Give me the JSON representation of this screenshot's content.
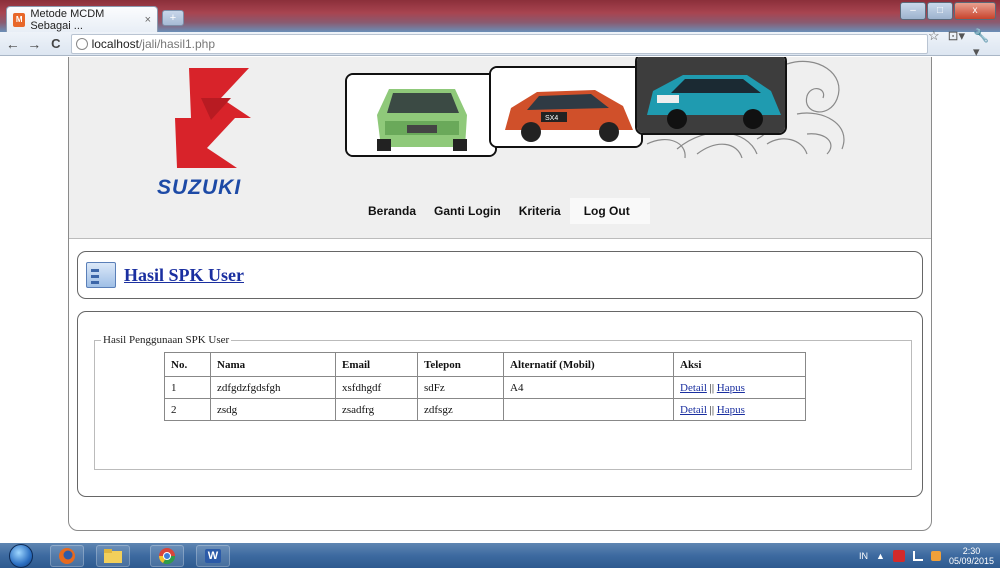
{
  "browser": {
    "tab_title": "Metode MCDM Sebagai ...",
    "tab_close": "×",
    "new_tab": "+",
    "address_host": "localhost",
    "address_path": "/jali/hasil1.php",
    "back": "←",
    "forward": "→",
    "reload": "C",
    "star": "☆",
    "page_menu": "⊡▾",
    "wrench_menu": "🔧▾",
    "win_minimize": "–",
    "win_maximize": "□",
    "win_close": "x"
  },
  "header": {
    "logo_text": "SUZUKI",
    "car_badge": "SX4"
  },
  "menu": {
    "items": [
      {
        "label": "Beranda"
      },
      {
        "label": "Ganti Login"
      },
      {
        "label": "Kriteria"
      },
      {
        "label": "Log Out"
      }
    ]
  },
  "page": {
    "title": "Hasil SPK User",
    "fieldset_legend": "Hasil Penggunaan SPK User"
  },
  "table": {
    "headers": [
      "No.",
      "Nama",
      "Email",
      "Telepon",
      "Alternatif (Mobil)",
      "Aksi"
    ],
    "rows": [
      {
        "no": "1",
        "nama": "zdfgdzfgdsfgh",
        "email": "xsfdhgdf",
        "telepon": "sdFz",
        "alternatif": "A4",
        "detail": "Detail",
        "sep": "||",
        "hapus": "Hapus"
      },
      {
        "no": "2",
        "nama": "zsdg",
        "email": "zsadfrg",
        "telepon": "zdfsgz",
        "alternatif": "",
        "detail": "Detail",
        "sep": "||",
        "hapus": "Hapus"
      }
    ]
  },
  "taskbar": {
    "lang": "IN",
    "tray_arrow": "▲",
    "time": "2:30",
    "date": "05/09/2015",
    "word_label": "W"
  },
  "colors": {
    "link": "#1a2fa0",
    "header_bg": "#efefef",
    "suzuki_red": "#d8232a",
    "suzuki_blue": "#1d4aa6"
  }
}
